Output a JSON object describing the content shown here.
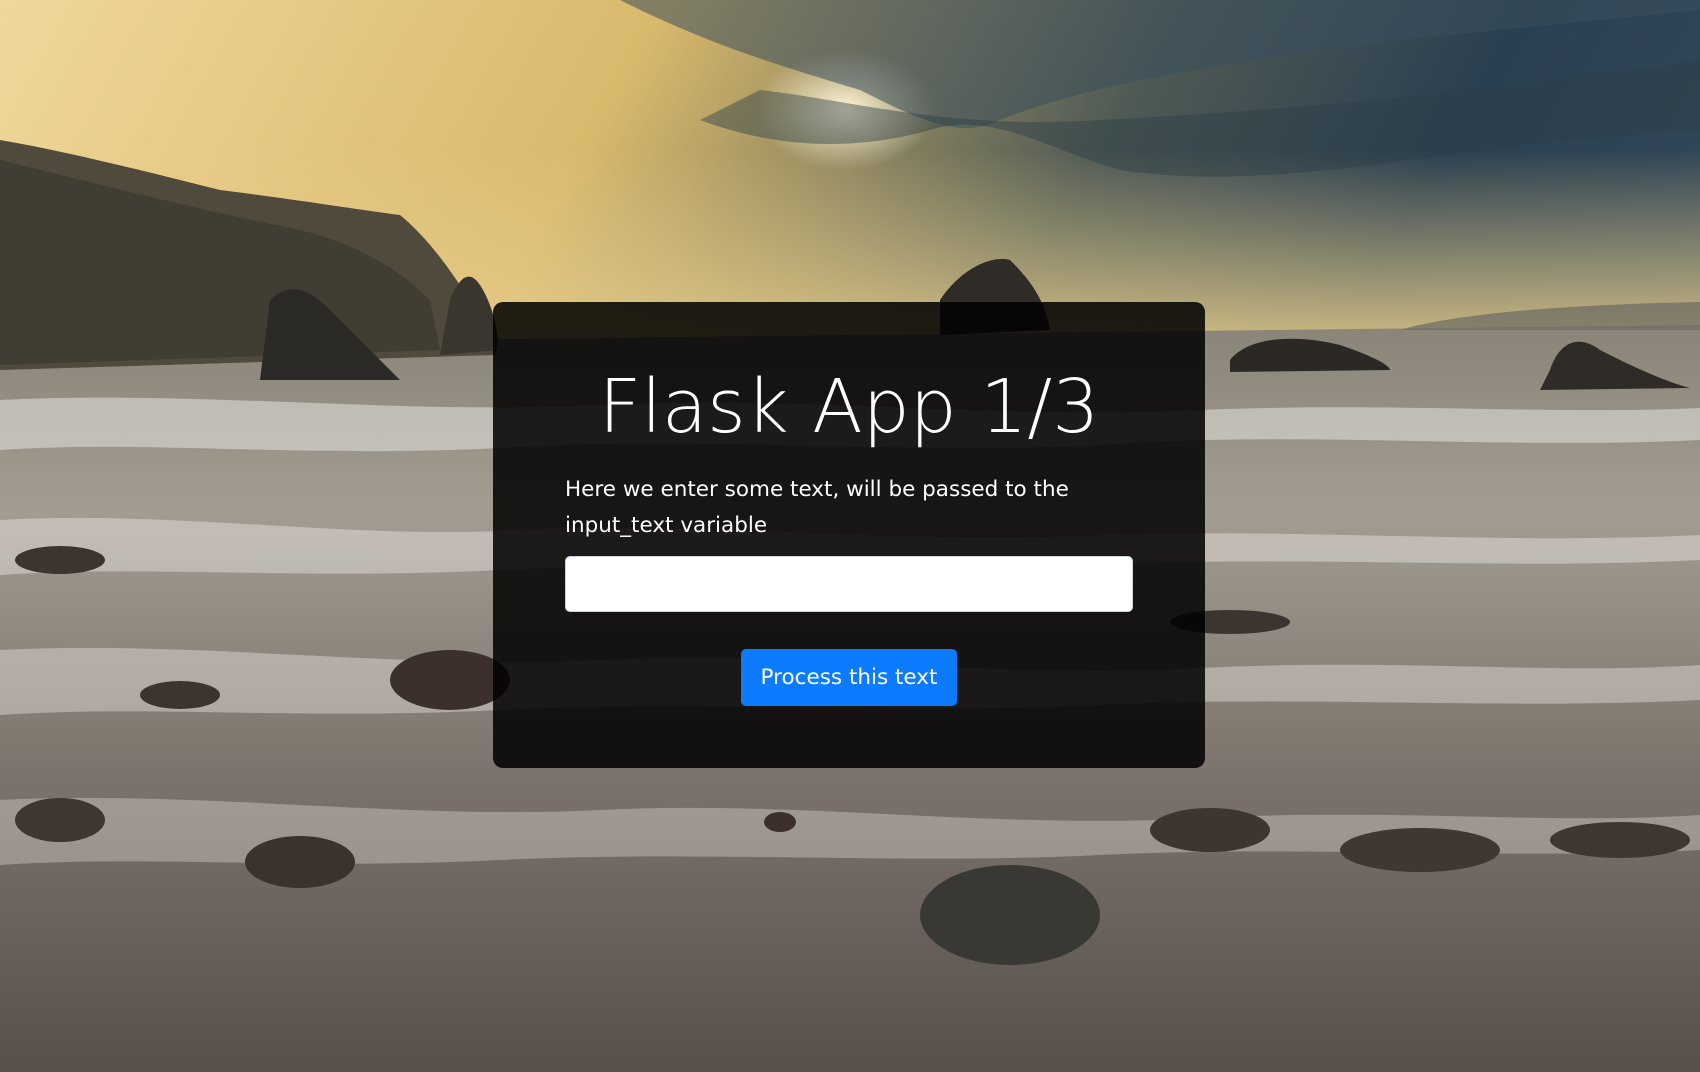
{
  "page": {
    "title": "Flask App 1/3",
    "description": "Here we enter some text, will be passed to the input_text variable"
  },
  "form": {
    "input_value": "",
    "input_placeholder": "",
    "submit_label": "Process this text"
  },
  "colors": {
    "button": "#0d7bff",
    "card": "#000000",
    "sky_warm": "#e8c878",
    "sky_cool": "#2e4456"
  }
}
